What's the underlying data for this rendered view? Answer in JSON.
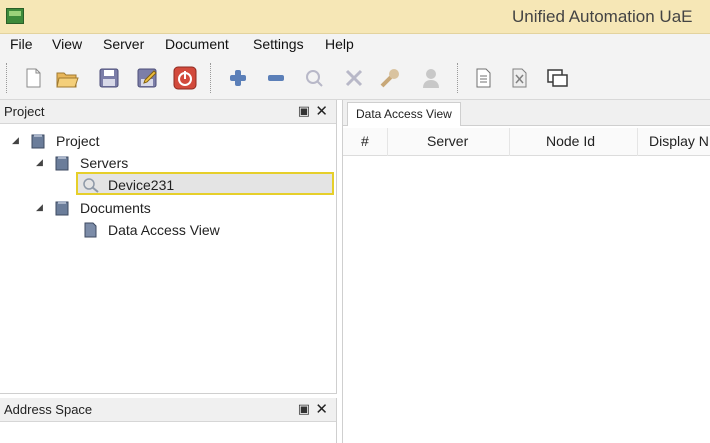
{
  "window": {
    "title": "Unified Automation UaE"
  },
  "menu": [
    "File",
    "View",
    "Server",
    "Document",
    "Settings",
    "Help"
  ],
  "toolbar": {
    "buttons": [
      "new-icon",
      "open-icon",
      "save-icon",
      "save-as-icon",
      "power-icon",
      "add-icon",
      "remove-icon",
      "connect-icon",
      "disconnect-icon",
      "properties-icon",
      "user-icon",
      "log-icon",
      "document-close-icon",
      "window-icon"
    ]
  },
  "project_panel": {
    "title": "Project",
    "tree": {
      "root": "Project",
      "servers": "Servers",
      "device": "Device231",
      "documents": "Documents",
      "data_access_view": "Data Access View"
    }
  },
  "address_panel": {
    "title": "Address Space"
  },
  "document": {
    "tab": "Data Access View",
    "columns": [
      "#",
      "Server",
      "Node Id",
      "Display N"
    ]
  },
  "colors": {
    "titlebar": "#f6e7b6",
    "selection_border": "#e6cf2a"
  }
}
